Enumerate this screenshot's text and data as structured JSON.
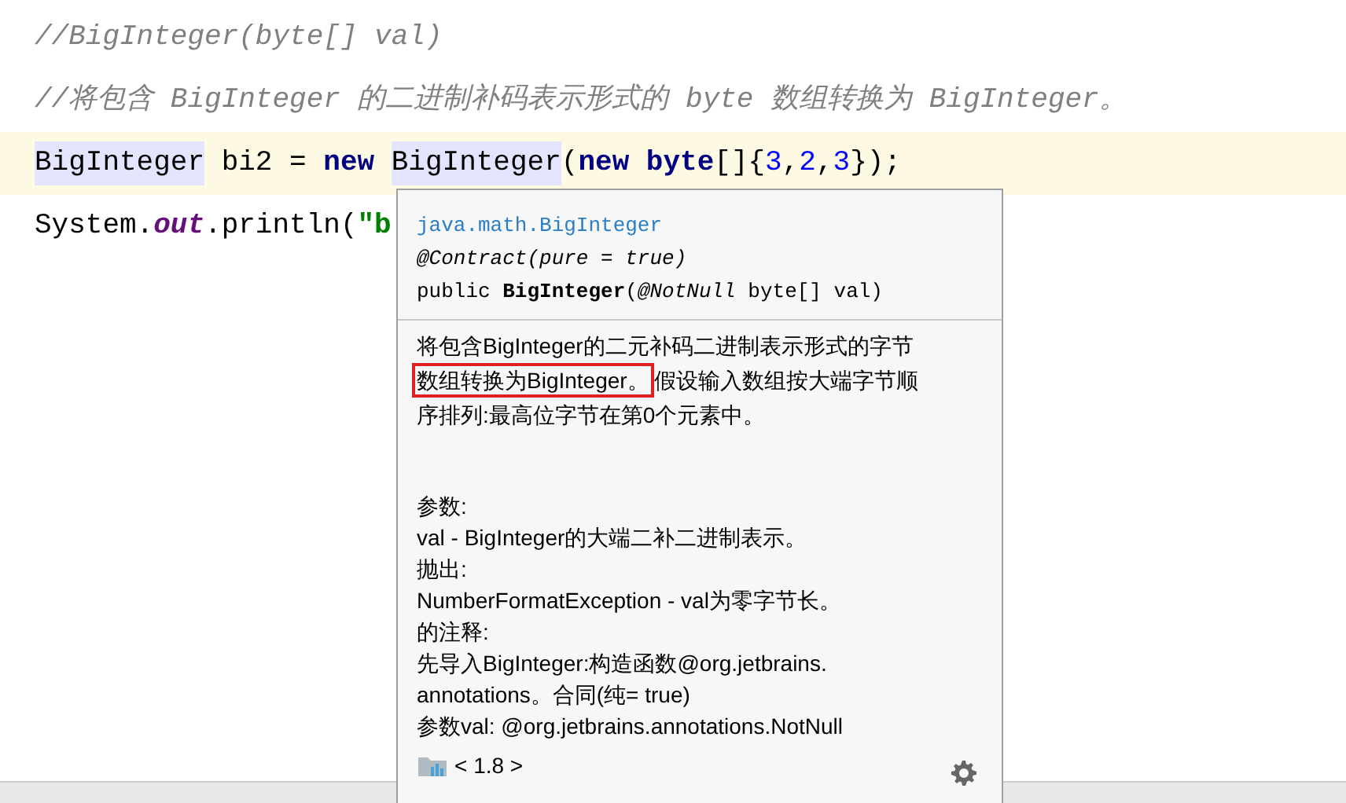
{
  "editor": {
    "lines": [
      {
        "current": false,
        "tokens": [
          {
            "kind": "comment",
            "text": "//BigInteger(byte[] val)"
          }
        ]
      },
      {
        "current": false,
        "tokens": [
          {
            "kind": "comment",
            "text": "//将包含 BigInteger 的二进制补码表示形式的 byte 数组转换为 BigInteger。"
          }
        ]
      },
      {
        "current": true,
        "tokens": [
          {
            "kind": "ref",
            "text": "BigInteger"
          },
          {
            "kind": "plain",
            "text": " bi2 = "
          },
          {
            "kind": "keyword",
            "text": "new "
          },
          {
            "kind": "ref",
            "text": "BigInteger"
          },
          {
            "kind": "plain",
            "text": "("
          },
          {
            "kind": "keyword",
            "text": "new byte"
          },
          {
            "kind": "plain",
            "text": "[]{"
          },
          {
            "kind": "number",
            "text": "3"
          },
          {
            "kind": "plain",
            "text": ","
          },
          {
            "kind": "number",
            "text": "2"
          },
          {
            "kind": "plain",
            "text": ","
          },
          {
            "kind": "number",
            "text": "3"
          },
          {
            "kind": "plain",
            "text": "});"
          }
        ]
      },
      {
        "current": false,
        "tokens": [
          {
            "kind": "plain",
            "text": "System."
          },
          {
            "kind": "field",
            "text": "out"
          },
          {
            "kind": "plain",
            "text": ".println("
          },
          {
            "kind": "string",
            "text": "\"b"
          }
        ]
      }
    ]
  },
  "doc_popup": {
    "package": "java.math.BigInteger",
    "annotation": "@Contract(pure = true)",
    "signature": [
      {
        "kind": "plain",
        "text": "public "
      },
      {
        "kind": "bold",
        "text": "BigInteger"
      },
      {
        "kind": "plain",
        "text": "("
      },
      {
        "kind": "italic",
        "text": "@NotNull"
      },
      {
        "kind": "plain",
        "text": " byte[] val)"
      }
    ],
    "description": [
      [
        {
          "boxed": false,
          "text": "将包含BigInteger的二元补码二进制表示形式的字节"
        }
      ],
      [
        {
          "boxed": true,
          "text": "数组转换为BigInteger。"
        },
        {
          "boxed": false,
          "text": "假设输入数组按大端字节顺"
        }
      ],
      [
        {
          "boxed": false,
          "text": "序排列:最高位字节在第0个元素中。"
        }
      ]
    ],
    "details": [
      "参数:",
      "val - BigInteger的大端二补二进制表示。",
      "抛出:",
      "NumberFormatException - val为零字节长。",
      "的注释:",
      "先导入BigInteger:构造函数@org.jetbrains.",
      "annotations。合同(纯= true)",
      "参数val: @org.jetbrains.annotations.NotNull"
    ],
    "version": "< 1.8 >"
  }
}
